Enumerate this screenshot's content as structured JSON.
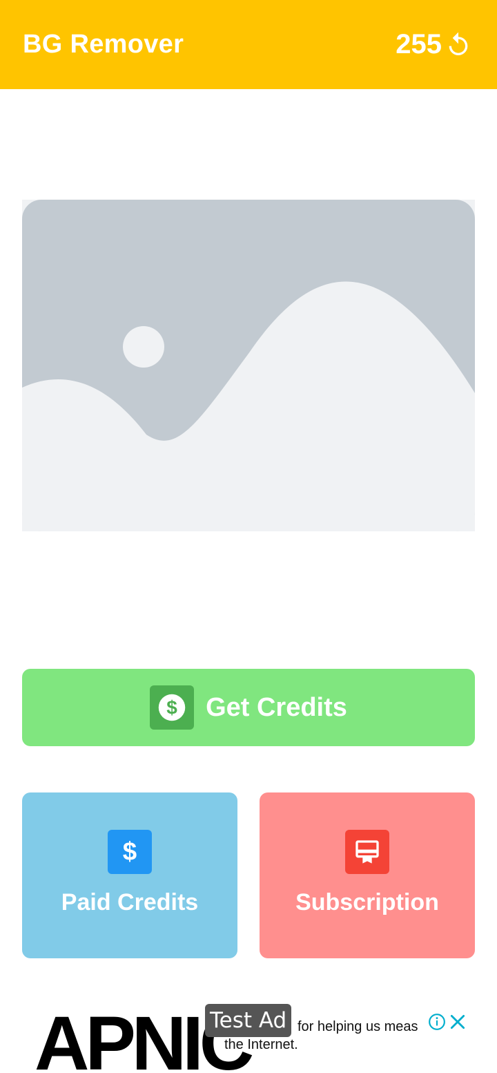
{
  "appbar": {
    "title": "BG Remover",
    "credits": "255",
    "refresh_icon": "refresh-icon"
  },
  "preview": {
    "icon": "image-placeholder-icon"
  },
  "actions": {
    "get_credits_label": "Get Credits",
    "get_credits_icon": "dollar-circle-icon",
    "paid_credits_label": "Paid Credits",
    "paid_credits_icon": "dollar-icon",
    "subscription_label": "Subscription",
    "subscription_icon": "card-membership-icon"
  },
  "ad": {
    "logo_text": "APNIC",
    "badge": "Test Ad",
    "line1": "for helping us meas",
    "line2": "the Internet.",
    "info_icon": "info-icon",
    "close_icon": "close-icon"
  },
  "colors": {
    "appbar": "#FFC400",
    "get_credits_bg": "#80E67F",
    "paid_credits_bg": "#81CBE8",
    "subscription_bg": "#FF8F8E"
  }
}
